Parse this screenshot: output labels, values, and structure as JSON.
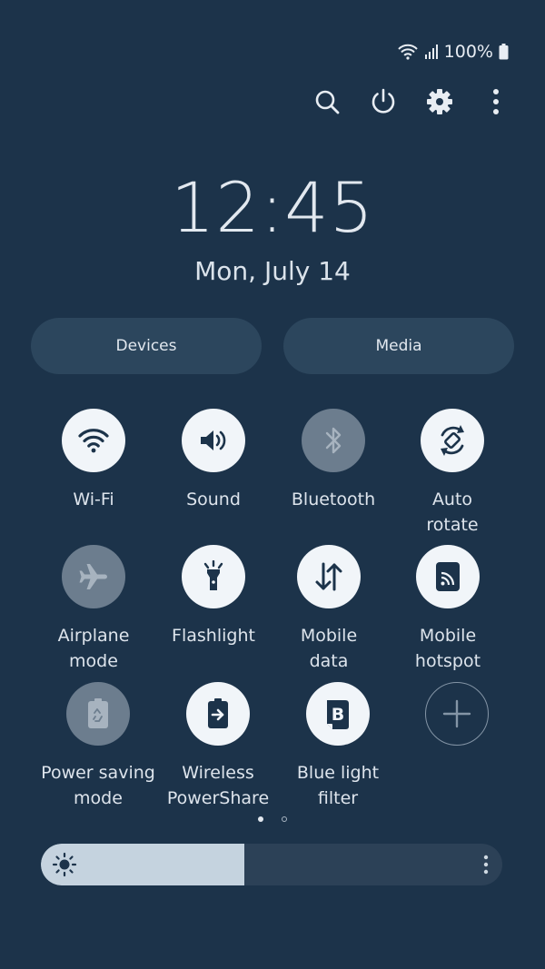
{
  "status": {
    "battery": "100%"
  },
  "header_actions": [
    {
      "name": "search-button",
      "icon": "search-icon"
    },
    {
      "name": "power-button",
      "icon": "power-icon"
    },
    {
      "name": "settings-button",
      "icon": "gear-icon"
    },
    {
      "name": "more-options-button",
      "icon": "more-vertical-icon"
    }
  ],
  "clock": {
    "time": "12:45",
    "date": "Mon, July 14"
  },
  "pills": {
    "devices": "Devices",
    "media": "Media"
  },
  "tiles": [
    {
      "label": "Wi-Fi",
      "icon": "wifi-icon",
      "state": "on"
    },
    {
      "label": "Sound",
      "icon": "speaker-icon",
      "state": "on"
    },
    {
      "label": "Bluetooth",
      "icon": "bluetooth-icon",
      "state": "off"
    },
    {
      "label": "Auto\nrotate",
      "icon": "rotate-icon",
      "state": "on"
    },
    {
      "label": "Airplane\nmode",
      "icon": "airplane-icon",
      "state": "off"
    },
    {
      "label": "Flashlight",
      "icon": "flashlight-icon",
      "state": "on"
    },
    {
      "label": "Mobile\ndata",
      "icon": "mobile-data-icon",
      "state": "on"
    },
    {
      "label": "Mobile\nhotspot",
      "icon": "hotspot-icon",
      "state": "on"
    },
    {
      "label": "Power saving\nmode",
      "icon": "battery-saver-icon",
      "state": "off"
    },
    {
      "label": "Wireless\nPowerShare",
      "icon": "powershare-icon",
      "state": "on"
    },
    {
      "label": "Blue light\nfilter",
      "icon": "blue-light-icon",
      "state": "on"
    },
    {
      "label": "",
      "icon": "add-icon",
      "state": "add"
    }
  ],
  "pager": {
    "pages": 2,
    "current": 1
  },
  "brightness": {
    "level": 0.44
  },
  "colors": {
    "background": "#1c334a",
    "tile_on": "#f1f5f9",
    "tile_off": "#6c7d8e",
    "icon_on": "#1c334a",
    "pill": "#2c465d",
    "brightness_fill": "#c5d3df"
  }
}
